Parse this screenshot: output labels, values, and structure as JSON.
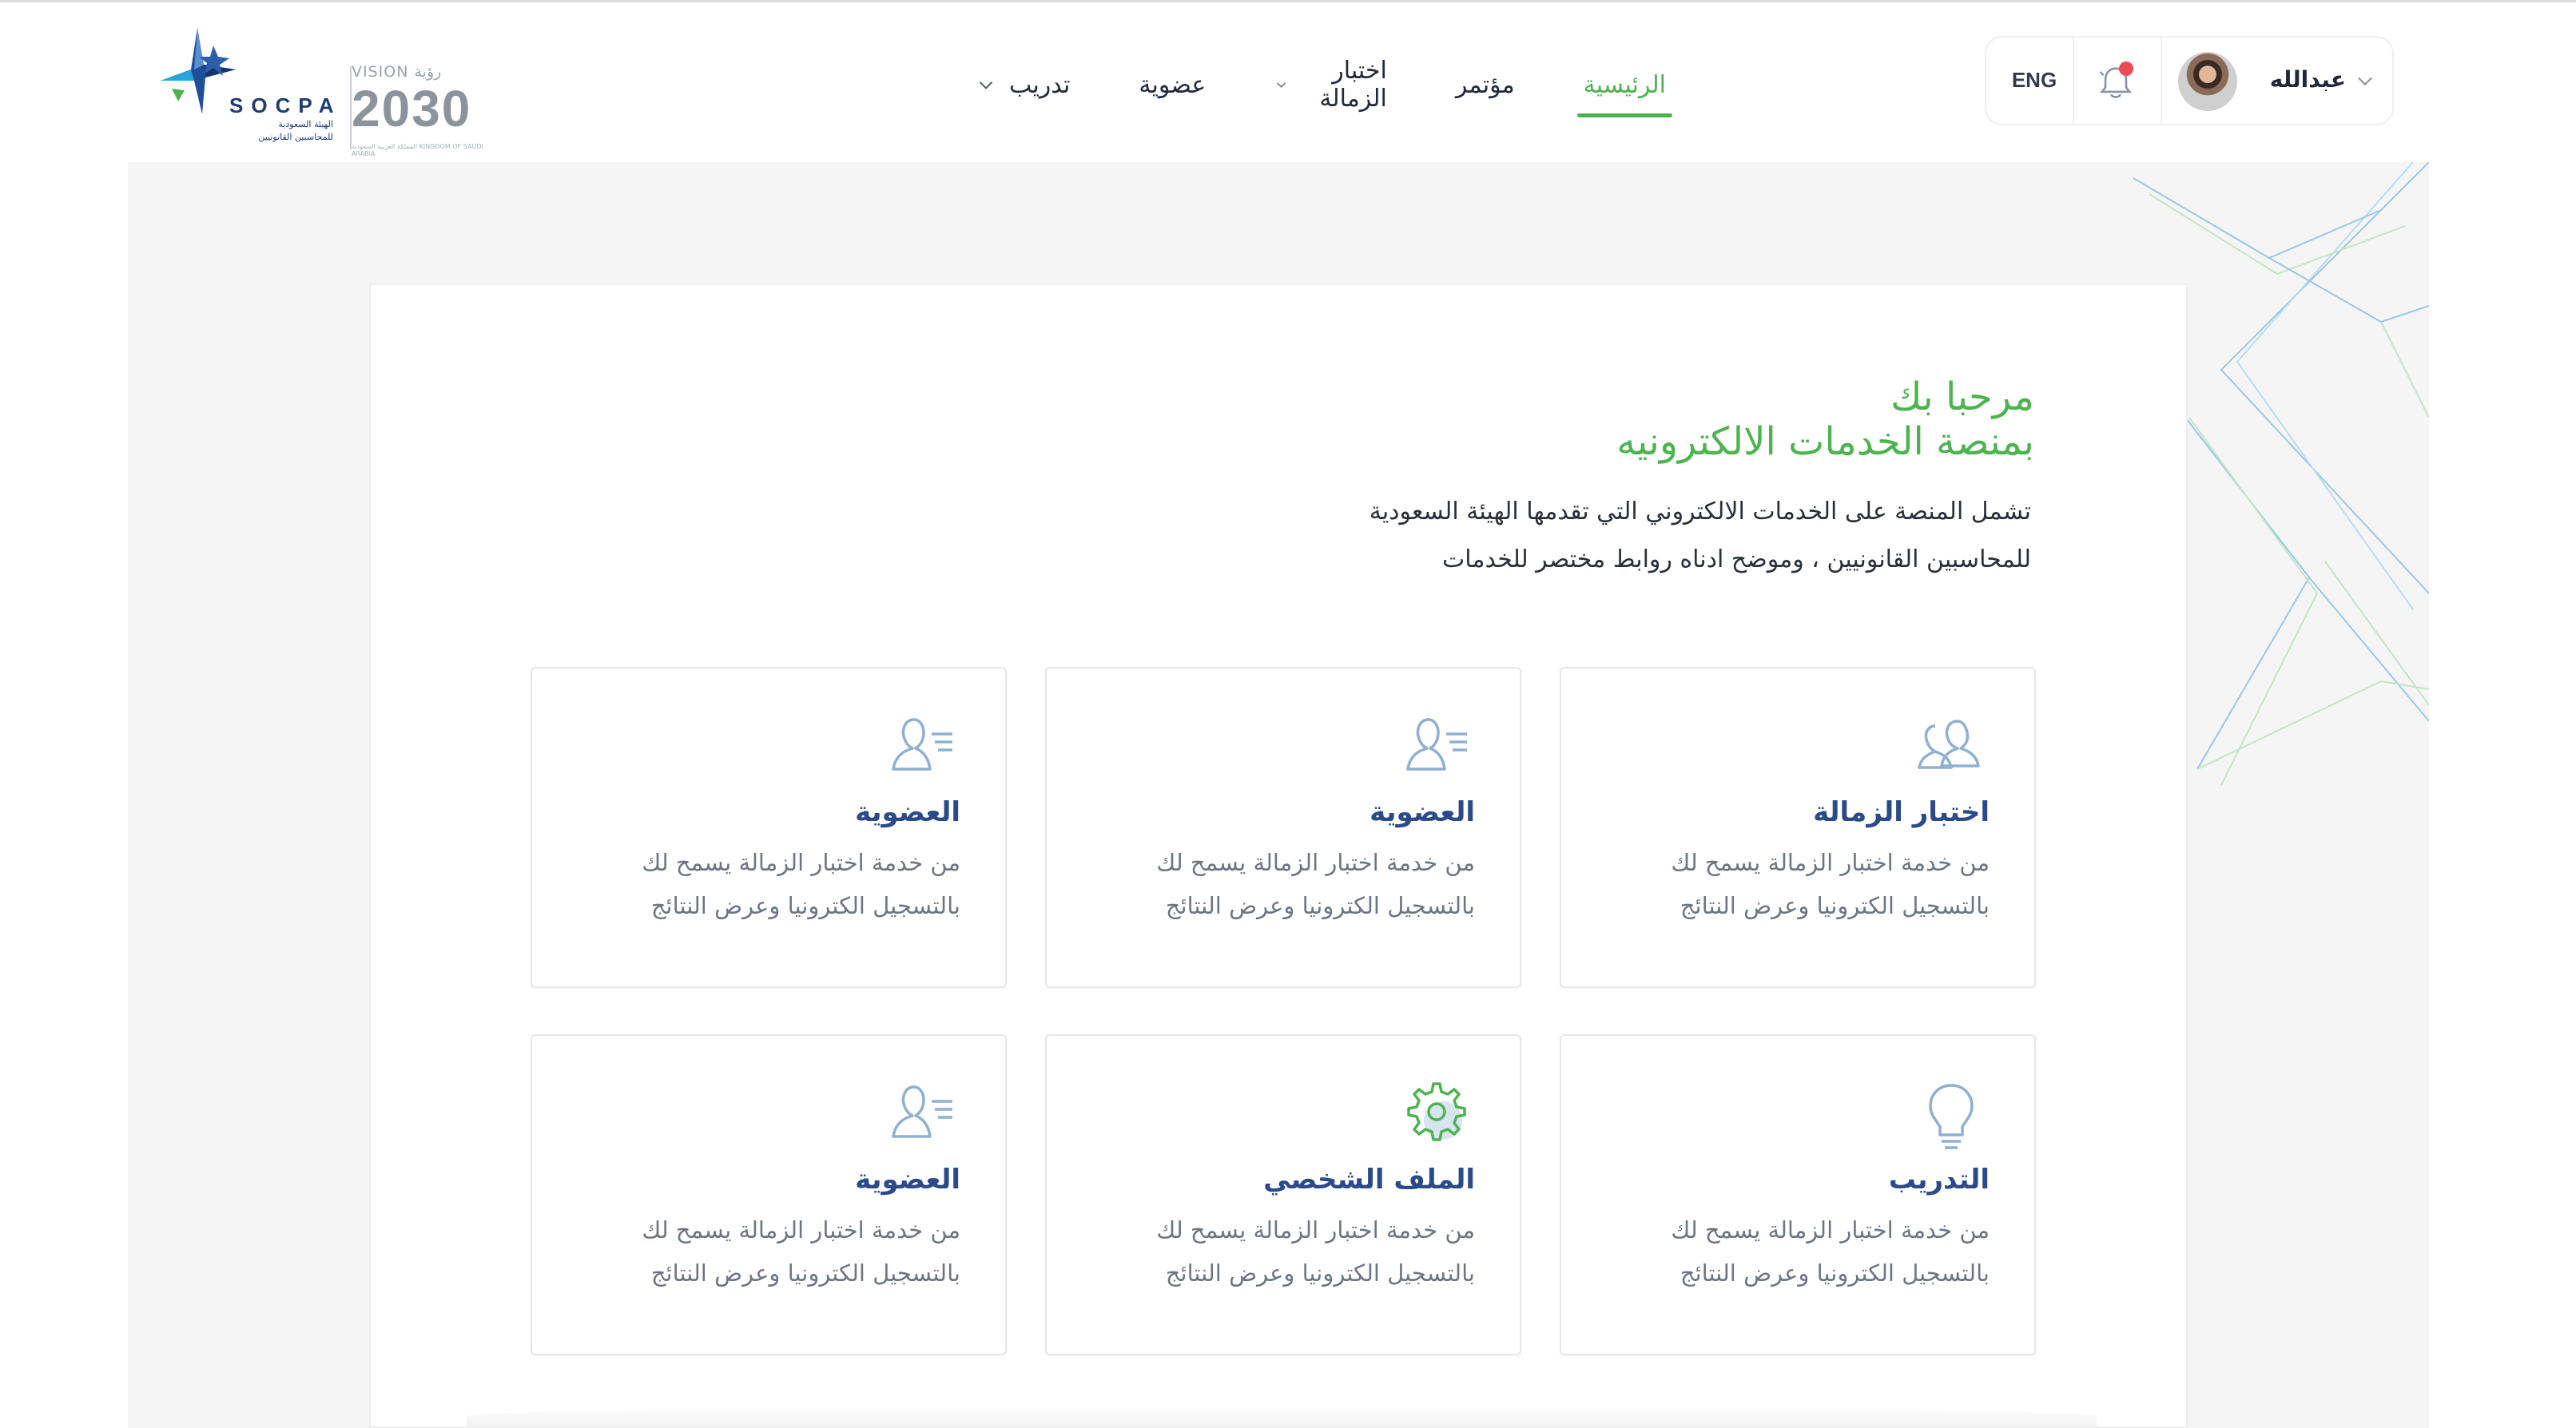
{
  "brand": {
    "org_name": "SOCPA",
    "org_arabic_line1": "الهيئة السعودية",
    "org_arabic_line2": "للمحاسبين القانونيين",
    "vision_label": "VISION رؤية",
    "vision_year": "2030",
    "vision_sub": "المملكة العربية السعودية KINGDOM OF SAUDI ARABIA"
  },
  "nav": {
    "items": [
      {
        "label": "الرئيسية",
        "active": true,
        "has_dropdown": false
      },
      {
        "label": "مؤتمر",
        "active": false,
        "has_dropdown": false
      },
      {
        "label": "اختبار الزمالة",
        "active": false,
        "has_dropdown": true
      },
      {
        "label": "عضوية",
        "active": false,
        "has_dropdown": false
      },
      {
        "label": "تدريب",
        "active": false,
        "has_dropdown": true
      }
    ]
  },
  "user": {
    "language_toggle": "ENG",
    "name": "عبدالله",
    "notification_icon": "bell-icon",
    "has_unread": true
  },
  "main": {
    "welcome_line1": "مرحبا بك",
    "welcome_line2": "بمنصة الخدمات الالكترونيه",
    "intro_line1": "تشمل المنصة على الخدمات الالكتروني التي تقدمها الهيئة السعودية",
    "intro_line2": "للمحاسبين القانونيين ، وموضح ادناه روابط مختصر للخدمات",
    "cards": [
      {
        "title": "اختبار الزمالة",
        "desc_line1": "من خدمة اختبار الزمالة يسمح لك",
        "desc_line2": "بالتسجيل الكترونيا وعرض النتائج",
        "icon": "users-icon"
      },
      {
        "title": "العضوية",
        "desc_line1": "من خدمة اختبار الزمالة يسمح لك",
        "desc_line2": "بالتسجيل الكترونيا وعرض النتائج",
        "icon": "user-list-icon"
      },
      {
        "title": "العضوية",
        "desc_line1": "من خدمة اختبار الزمالة يسمح لك",
        "desc_line2": "بالتسجيل الكترونيا وعرض النتائج",
        "icon": "user-list-icon"
      },
      {
        "title": "التدريب",
        "desc_line1": "من خدمة اختبار الزمالة يسمح لك",
        "desc_line2": "بالتسجيل الكترونيا وعرض النتائج",
        "icon": "lightbulb-icon"
      },
      {
        "title": "الملف الشخصي",
        "desc_line1": "من خدمة اختبار الزمالة يسمح لك",
        "desc_line2": "بالتسجيل الكترونيا وعرض النتائج",
        "icon": "gear-icon"
      },
      {
        "title": "العضوية",
        "desc_line1": "من خدمة اختبار الزمالة يسمح لك",
        "desc_line2": "بالتسجيل الكترونيا وعرض النتائج",
        "icon": "user-list-icon"
      }
    ]
  },
  "colors": {
    "accent_green": "#4db34f",
    "title_blue": "#2b4a8a",
    "icon_blue": "#8fb0d2",
    "notification_red": "#ee4a55"
  }
}
